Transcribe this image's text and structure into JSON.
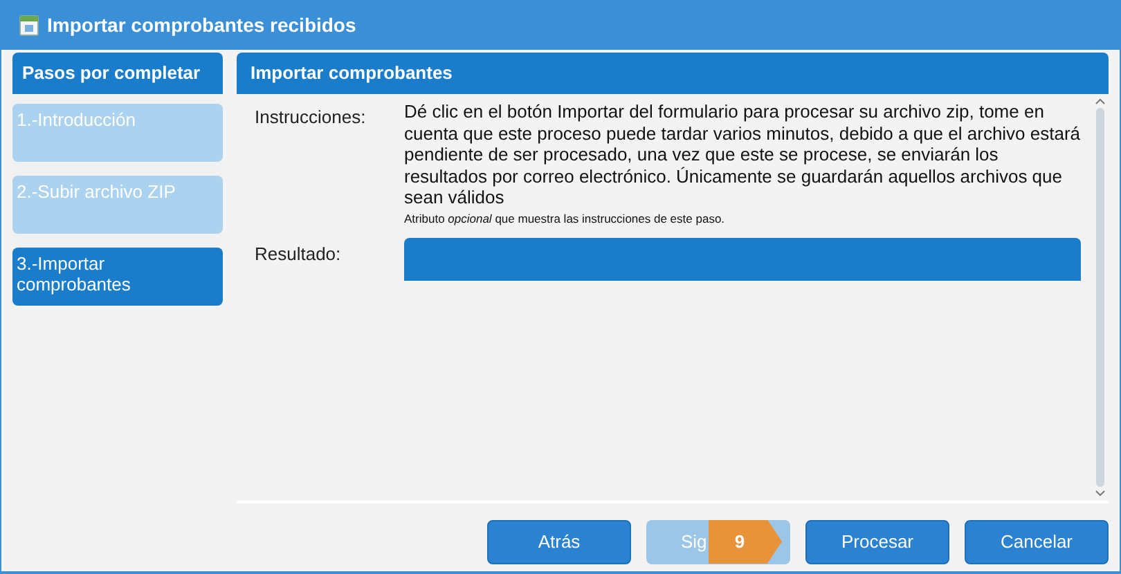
{
  "window": {
    "title": "Importar comprobantes recibidos"
  },
  "steps_panel": {
    "title": "Pasos por completar",
    "steps": [
      {
        "label": "1.-Introducción",
        "selected": false
      },
      {
        "label": "2.-Subir archivo ZIP",
        "selected": false
      },
      {
        "label": "3.-Importar comprobantes",
        "selected": true
      }
    ]
  },
  "content": {
    "title": "Importar comprobantes",
    "fields": [
      {
        "kind": "text",
        "label": "Instrucciones:",
        "value": "Dé clic en el botón Importar del formulario para procesar su archivo zip, tome en cuenta que este proceso puede tardar varios minutos, debido a que el archivo estará pendiente de ser procesado, una vez que este se procese, se enviarán los resultados por correo electrónico. Únicamente se guardarán aquellos archivos que sean válidos",
        "hint": "Atributo *opcional* que muestra las instrucciones de este paso."
      },
      {
        "kind": "bar",
        "label": "Resultado:"
      }
    ]
  },
  "buttons": [
    {
      "label": "Atrás",
      "disabled": false
    },
    {
      "label": "Sig",
      "disabled": true,
      "badge": "9"
    },
    {
      "label": "Procesar",
      "disabled": false
    },
    {
      "label": "Cancelar",
      "disabled": false
    }
  ]
}
